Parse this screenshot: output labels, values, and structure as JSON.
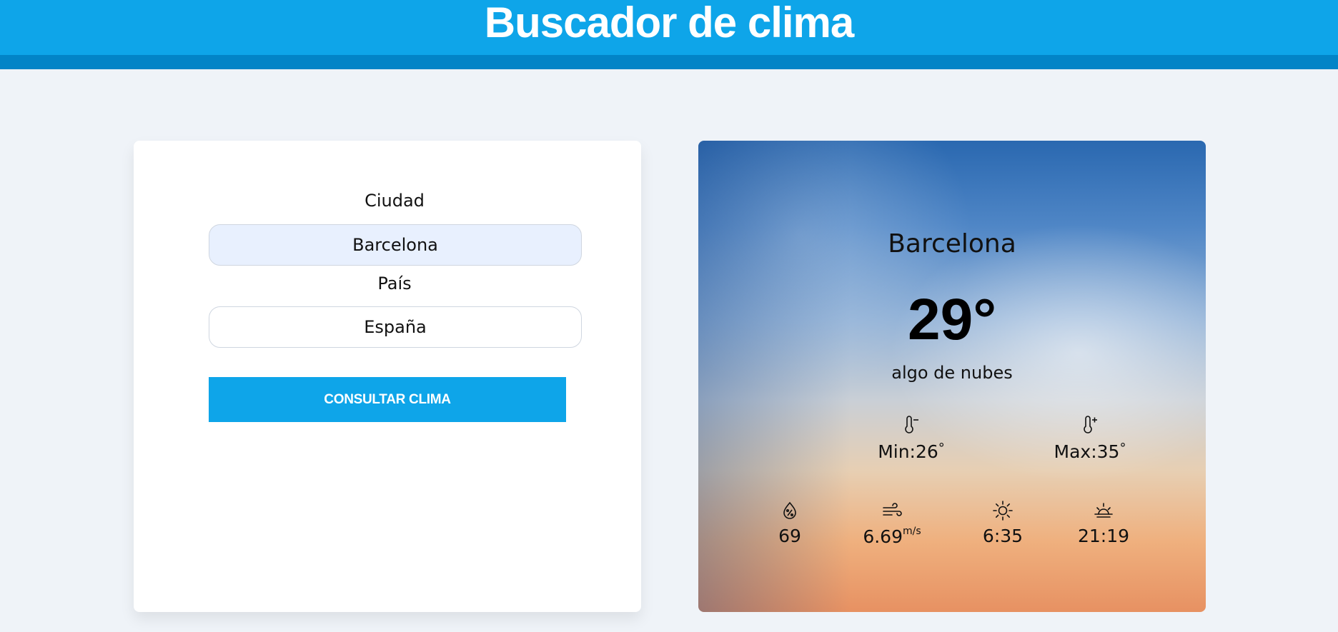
{
  "header": {
    "title": "Buscador de clima"
  },
  "form": {
    "city_label": "Ciudad",
    "city_value": "Barcelona",
    "country_label": "País",
    "country_value": "España",
    "submit_label": "CONSULTAR CLIMA"
  },
  "weather": {
    "city": "Barcelona",
    "temperature": "29°",
    "description": "algo de nubes",
    "min": "Min:26",
    "max": "Max:35",
    "degree_symbol": "°",
    "humidity": "69",
    "wind": "6.69",
    "wind_unit": "m/s",
    "sunrise": "6:35",
    "sunset": "21:19"
  },
  "icons": {
    "temp_min": "thermometer-minus-icon",
    "temp_max": "thermometer-plus-icon",
    "humidity": "droplet-percent-icon",
    "wind": "wind-icon",
    "sunrise": "sun-icon",
    "sunset": "sunset-icon"
  },
  "colors": {
    "primary": "#0ea5e9",
    "primary_dark": "#0284c7",
    "background": "#eff3f8"
  }
}
